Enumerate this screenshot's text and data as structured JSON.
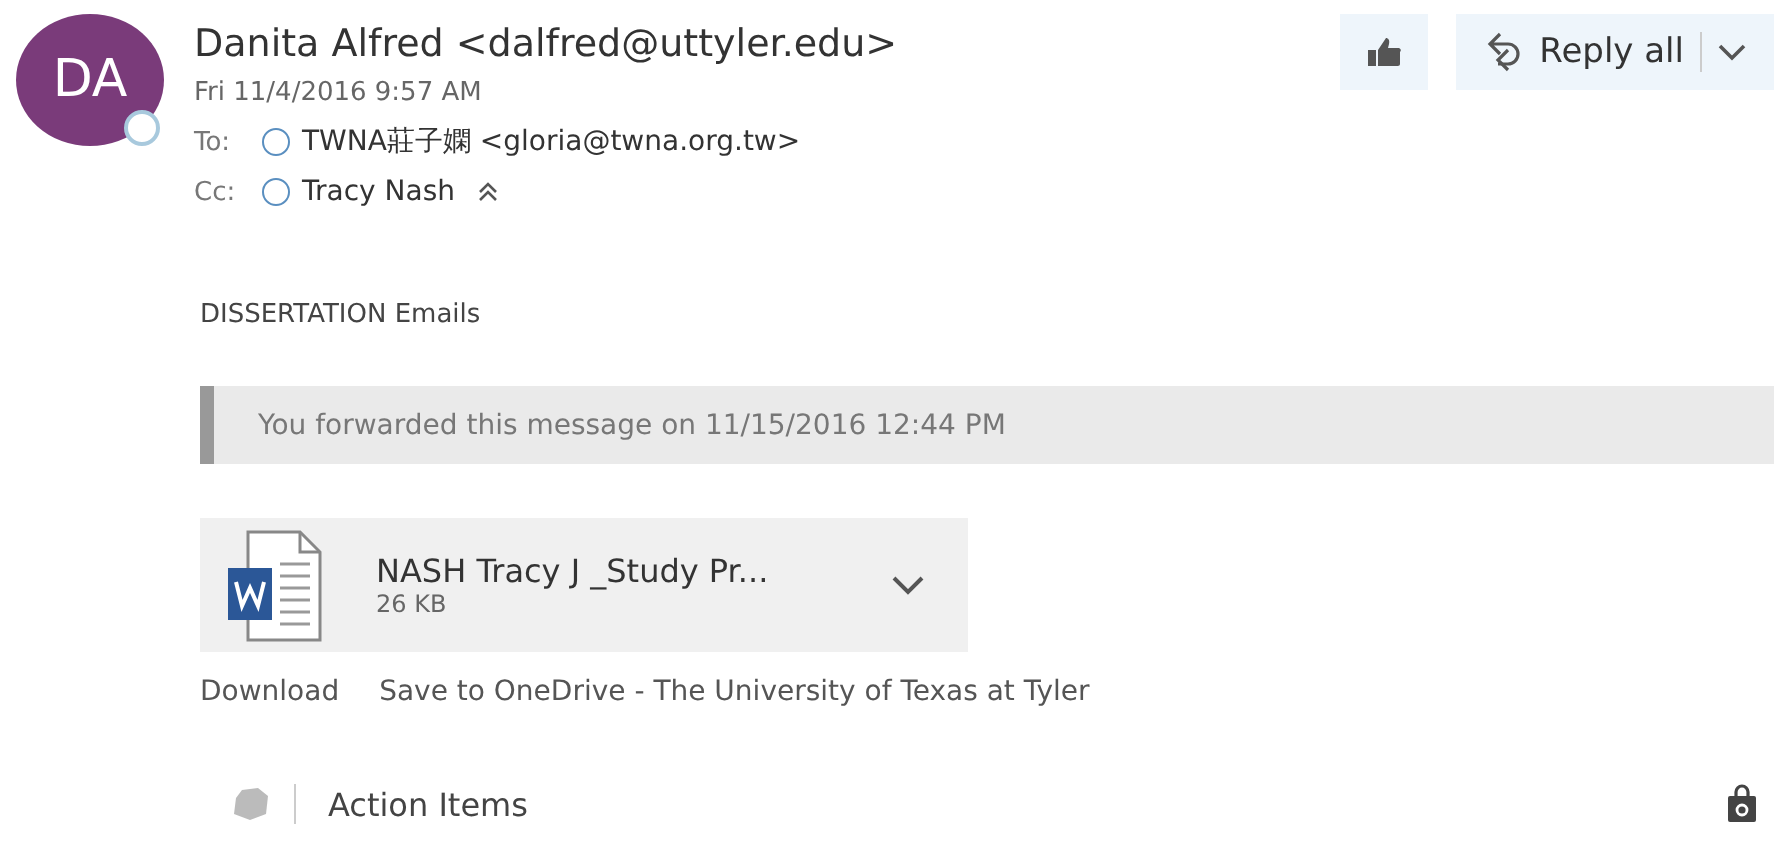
{
  "sender": {
    "initials": "DA",
    "name": "Danita Alfred <dalfred@uttyler.edu>",
    "date": "Fri 11/4/2016 9:57 AM",
    "online": false
  },
  "recipients": [
    {
      "label": "To:",
      "name": "TWNA莊子嫻 <gloria@twna.org.tw>"
    },
    {
      "label": "Cc:",
      "name": "Tracy Nash"
    }
  ],
  "actions": {
    "reply_all": "Reply all"
  },
  "body": "DISSERTATION Emails",
  "notice": "You forwarded this message on 11/15/2016 12:44 PM",
  "attachment": {
    "name": "NASH Tracy J _Study Pr...",
    "size": "26 KB"
  },
  "attachment_links": [
    "Download",
    "Save to OneDrive - The University of Texas at Tyler"
  ],
  "footer": {
    "label": "Action Items"
  }
}
